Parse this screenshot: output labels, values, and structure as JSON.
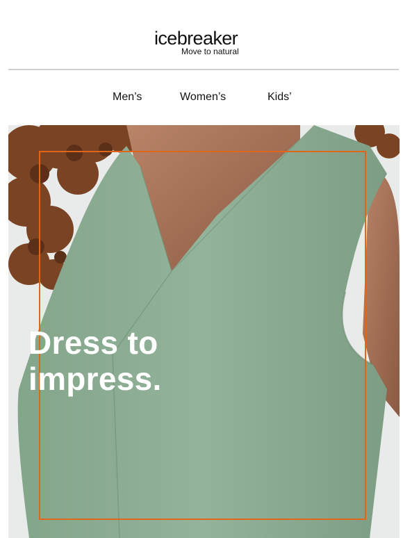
{
  "brand": {
    "name": "icebreaker",
    "tagline": "Move to natural"
  },
  "nav": {
    "items": [
      {
        "label": "Men’s"
      },
      {
        "label": "Women’s"
      },
      {
        "label": "Kids’"
      }
    ]
  },
  "hero": {
    "headline_line1": "Dress to",
    "headline_line2": "impress.",
    "frame_color": "#e0661c",
    "dress_color": "#8fae95"
  }
}
